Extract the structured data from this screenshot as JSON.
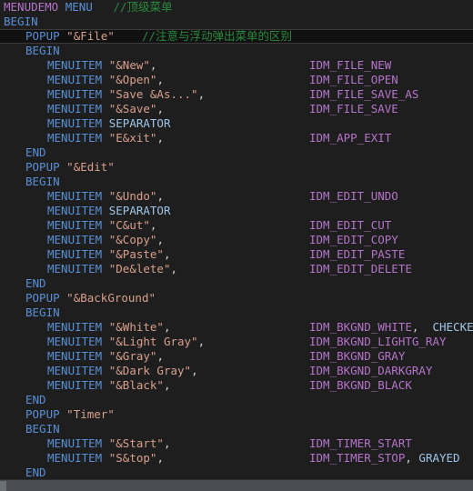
{
  "editor": {
    "language": "rc",
    "current_line_index": 2,
    "colors": {
      "background": "#1e1e1e",
      "current_line_background": "#111111",
      "type_identifier": "#b474c8",
      "block_keyword": "#5a8fd6",
      "light_keyword": "#9fc6e8",
      "string": "#d8a08c",
      "comment": "#2a8a3e",
      "scrollbar_track": "#4a4d52",
      "scrollbar_thumb": "#6b6f76"
    },
    "lines": [
      {
        "indent": 0,
        "tokens": [
          {
            "t": "MENUDEMO",
            "c": "kw-type"
          },
          {
            "t": " ",
            "c": "punct"
          },
          {
            "t": "MENU",
            "c": "kw-block"
          },
          {
            "t": "   ",
            "c": "punct"
          },
          {
            "t": "//顶级菜单",
            "c": "cmt"
          }
        ],
        "ident": ""
      },
      {
        "indent": 0,
        "tokens": [
          {
            "t": "BEGIN",
            "c": "kw-block"
          }
        ],
        "ident": ""
      },
      {
        "indent": 1,
        "tokens": [
          {
            "t": "POPUP",
            "c": "kw-block"
          },
          {
            "t": " ",
            "c": "punct"
          },
          {
            "t": "\"&File\"",
            "c": "str"
          },
          {
            "t": "    ",
            "c": "punct"
          },
          {
            "t": "//注意与浮动弹出菜单的区别",
            "c": "cmt"
          }
        ],
        "ident": ""
      },
      {
        "indent": 1,
        "tokens": [
          {
            "t": "BEGIN",
            "c": "kw-block"
          }
        ],
        "ident": ""
      },
      {
        "indent": 2,
        "tokens": [
          {
            "t": "MENUITEM",
            "c": "kw-block"
          },
          {
            "t": " ",
            "c": "punct"
          },
          {
            "t": "\"&New\"",
            "c": "str"
          },
          {
            "t": ",",
            "c": "punct"
          }
        ],
        "ident": "IDM_FILE_NEW",
        "ident_class": "kw-type"
      },
      {
        "indent": 2,
        "tokens": [
          {
            "t": "MENUITEM",
            "c": "kw-block"
          },
          {
            "t": " ",
            "c": "punct"
          },
          {
            "t": "\"&Open\"",
            "c": "str"
          },
          {
            "t": ",",
            "c": "punct"
          }
        ],
        "ident": "IDM_FILE_OPEN",
        "ident_class": "kw-type"
      },
      {
        "indent": 2,
        "tokens": [
          {
            "t": "MENUITEM",
            "c": "kw-block"
          },
          {
            "t": " ",
            "c": "punct"
          },
          {
            "t": "\"Save &As...\"",
            "c": "str"
          },
          {
            "t": ",",
            "c": "punct"
          }
        ],
        "ident": "IDM_FILE_SAVE_AS",
        "ident_class": "kw-type"
      },
      {
        "indent": 2,
        "tokens": [
          {
            "t": "MENUITEM",
            "c": "kw-block"
          },
          {
            "t": " ",
            "c": "punct"
          },
          {
            "t": "\"&Save\"",
            "c": "str"
          },
          {
            "t": ",",
            "c": "punct"
          }
        ],
        "ident": "IDM_FILE_SAVE",
        "ident_class": "kw-type"
      },
      {
        "indent": 2,
        "tokens": [
          {
            "t": "MENUITEM",
            "c": "kw-block"
          },
          {
            "t": " ",
            "c": "punct"
          },
          {
            "t": "SEPARATOR",
            "c": "kw-light"
          }
        ],
        "ident": ""
      },
      {
        "indent": 2,
        "tokens": [
          {
            "t": "MENUITEM",
            "c": "kw-block"
          },
          {
            "t": " ",
            "c": "punct"
          },
          {
            "t": "\"E&xit\"",
            "c": "str"
          },
          {
            "t": ",",
            "c": "punct"
          }
        ],
        "ident": "IDM_APP_EXIT",
        "ident_class": "kw-type"
      },
      {
        "indent": 1,
        "tokens": [
          {
            "t": "END",
            "c": "kw-block"
          }
        ],
        "ident": ""
      },
      {
        "indent": 1,
        "tokens": [
          {
            "t": "POPUP",
            "c": "kw-block"
          },
          {
            "t": " ",
            "c": "punct"
          },
          {
            "t": "\"&Edit\"",
            "c": "str"
          }
        ],
        "ident": ""
      },
      {
        "indent": 1,
        "tokens": [
          {
            "t": "BEGIN",
            "c": "kw-block"
          }
        ],
        "ident": ""
      },
      {
        "indent": 2,
        "tokens": [
          {
            "t": "MENUITEM",
            "c": "kw-block"
          },
          {
            "t": " ",
            "c": "punct"
          },
          {
            "t": "\"&Undo\"",
            "c": "str"
          },
          {
            "t": ",",
            "c": "punct"
          }
        ],
        "ident": "IDM_EDIT_UNDO",
        "ident_class": "kw-type"
      },
      {
        "indent": 2,
        "tokens": [
          {
            "t": "MENUITEM",
            "c": "kw-block"
          },
          {
            "t": " ",
            "c": "punct"
          },
          {
            "t": "SEPARATOR",
            "c": "kw-light"
          }
        ],
        "ident": ""
      },
      {
        "indent": 2,
        "tokens": [
          {
            "t": "MENUITEM",
            "c": "kw-block"
          },
          {
            "t": " ",
            "c": "punct"
          },
          {
            "t": "\"C&ut\"",
            "c": "str"
          },
          {
            "t": ",",
            "c": "punct"
          }
        ],
        "ident": "IDM_EDIT_CUT",
        "ident_class": "kw-type"
      },
      {
        "indent": 2,
        "tokens": [
          {
            "t": "MENUITEM",
            "c": "kw-block"
          },
          {
            "t": " ",
            "c": "punct"
          },
          {
            "t": "\"&Copy\"",
            "c": "str"
          },
          {
            "t": ",",
            "c": "punct"
          }
        ],
        "ident": "IDM_EDIT_COPY",
        "ident_class": "kw-type"
      },
      {
        "indent": 2,
        "tokens": [
          {
            "t": "MENUITEM",
            "c": "kw-block"
          },
          {
            "t": " ",
            "c": "punct"
          },
          {
            "t": "\"&Paste\"",
            "c": "str"
          },
          {
            "t": ",",
            "c": "punct"
          }
        ],
        "ident": "IDM_EDIT_PASTE",
        "ident_class": "kw-type"
      },
      {
        "indent": 2,
        "tokens": [
          {
            "t": "MENUITEM",
            "c": "kw-block"
          },
          {
            "t": " ",
            "c": "punct"
          },
          {
            "t": "\"De&lete\"",
            "c": "str"
          },
          {
            "t": ",",
            "c": "punct"
          }
        ],
        "ident": "IDM_EDIT_DELETE",
        "ident_class": "kw-type"
      },
      {
        "indent": 1,
        "tokens": [
          {
            "t": "END",
            "c": "kw-block"
          }
        ],
        "ident": ""
      },
      {
        "indent": 1,
        "tokens": [
          {
            "t": "POPUP",
            "c": "kw-block"
          },
          {
            "t": " ",
            "c": "punct"
          },
          {
            "t": "\"&BackGround\"",
            "c": "str"
          }
        ],
        "ident": ""
      },
      {
        "indent": 1,
        "tokens": [
          {
            "t": "BEGIN",
            "c": "kw-block"
          }
        ],
        "ident": ""
      },
      {
        "indent": 2,
        "tokens": [
          {
            "t": "MENUITEM",
            "c": "kw-block"
          },
          {
            "t": " ",
            "c": "punct"
          },
          {
            "t": "\"&White\"",
            "c": "str"
          },
          {
            "t": ",",
            "c": "punct"
          }
        ],
        "ident": "IDM_BKGND_WHITE,  CHECKED",
        "ident_class": "kw-type",
        "ident_tokens": [
          {
            "t": "IDM_BKGND_WHITE",
            "c": "kw-type"
          },
          {
            "t": ",  ",
            "c": "punct"
          },
          {
            "t": "CHECKED",
            "c": "kw-light"
          }
        ]
      },
      {
        "indent": 2,
        "tokens": [
          {
            "t": "MENUITEM",
            "c": "kw-block"
          },
          {
            "t": " ",
            "c": "punct"
          },
          {
            "t": "\"&Light Gray\"",
            "c": "str"
          },
          {
            "t": ",",
            "c": "punct"
          }
        ],
        "ident": "IDM_BKGND_LIGHTG_RAY",
        "ident_class": "kw-type"
      },
      {
        "indent": 2,
        "tokens": [
          {
            "t": "MENUITEM",
            "c": "kw-block"
          },
          {
            "t": " ",
            "c": "punct"
          },
          {
            "t": "\"&Gray\"",
            "c": "str"
          },
          {
            "t": ",",
            "c": "punct"
          }
        ],
        "ident": "IDM_BKGND_GRAY",
        "ident_class": "kw-type"
      },
      {
        "indent": 2,
        "tokens": [
          {
            "t": "MENUITEM",
            "c": "kw-block"
          },
          {
            "t": " ",
            "c": "punct"
          },
          {
            "t": "\"&Dark Gray\"",
            "c": "str"
          },
          {
            "t": ",",
            "c": "punct"
          }
        ],
        "ident": "IDM_BKGND_DARKGRAY",
        "ident_class": "kw-type"
      },
      {
        "indent": 2,
        "tokens": [
          {
            "t": "MENUITEM",
            "c": "kw-block"
          },
          {
            "t": " ",
            "c": "punct"
          },
          {
            "t": "\"&Black\"",
            "c": "str"
          },
          {
            "t": ",",
            "c": "punct"
          }
        ],
        "ident": "IDM_BKGND_BLACK",
        "ident_class": "kw-type"
      },
      {
        "indent": 1,
        "tokens": [
          {
            "t": "END",
            "c": "kw-block"
          }
        ],
        "ident": ""
      },
      {
        "indent": 1,
        "tokens": [
          {
            "t": "POPUP",
            "c": "kw-block"
          },
          {
            "t": " ",
            "c": "punct"
          },
          {
            "t": "\"Timer\"",
            "c": "str"
          }
        ],
        "ident": ""
      },
      {
        "indent": 1,
        "tokens": [
          {
            "t": "BEGIN",
            "c": "kw-block"
          }
        ],
        "ident": ""
      },
      {
        "indent": 2,
        "tokens": [
          {
            "t": "MENUITEM",
            "c": "kw-block"
          },
          {
            "t": " ",
            "c": "punct"
          },
          {
            "t": "\"&Start\"",
            "c": "str"
          },
          {
            "t": ",",
            "c": "punct"
          }
        ],
        "ident": "IDM_TIMER_START",
        "ident_class": "kw-type"
      },
      {
        "indent": 2,
        "tokens": [
          {
            "t": "MENUITEM",
            "c": "kw-block"
          },
          {
            "t": " ",
            "c": "punct"
          },
          {
            "t": "\"S&top\"",
            "c": "str"
          },
          {
            "t": ",",
            "c": "punct"
          }
        ],
        "ident": "IDM_TIMER_STOP, GRAYED",
        "ident_class": "kw-type",
        "ident_tokens": [
          {
            "t": "IDM_TIMER_STOP",
            "c": "kw-type"
          },
          {
            "t": ", ",
            "c": "punct"
          },
          {
            "t": "GRAYED",
            "c": "kw-light"
          }
        ]
      },
      {
        "indent": 1,
        "tokens": [
          {
            "t": "END",
            "c": "kw-block"
          }
        ],
        "ident": ""
      }
    ]
  },
  "scrollbar": {
    "orientation": "horizontal",
    "thumb_position_percent": 0
  }
}
